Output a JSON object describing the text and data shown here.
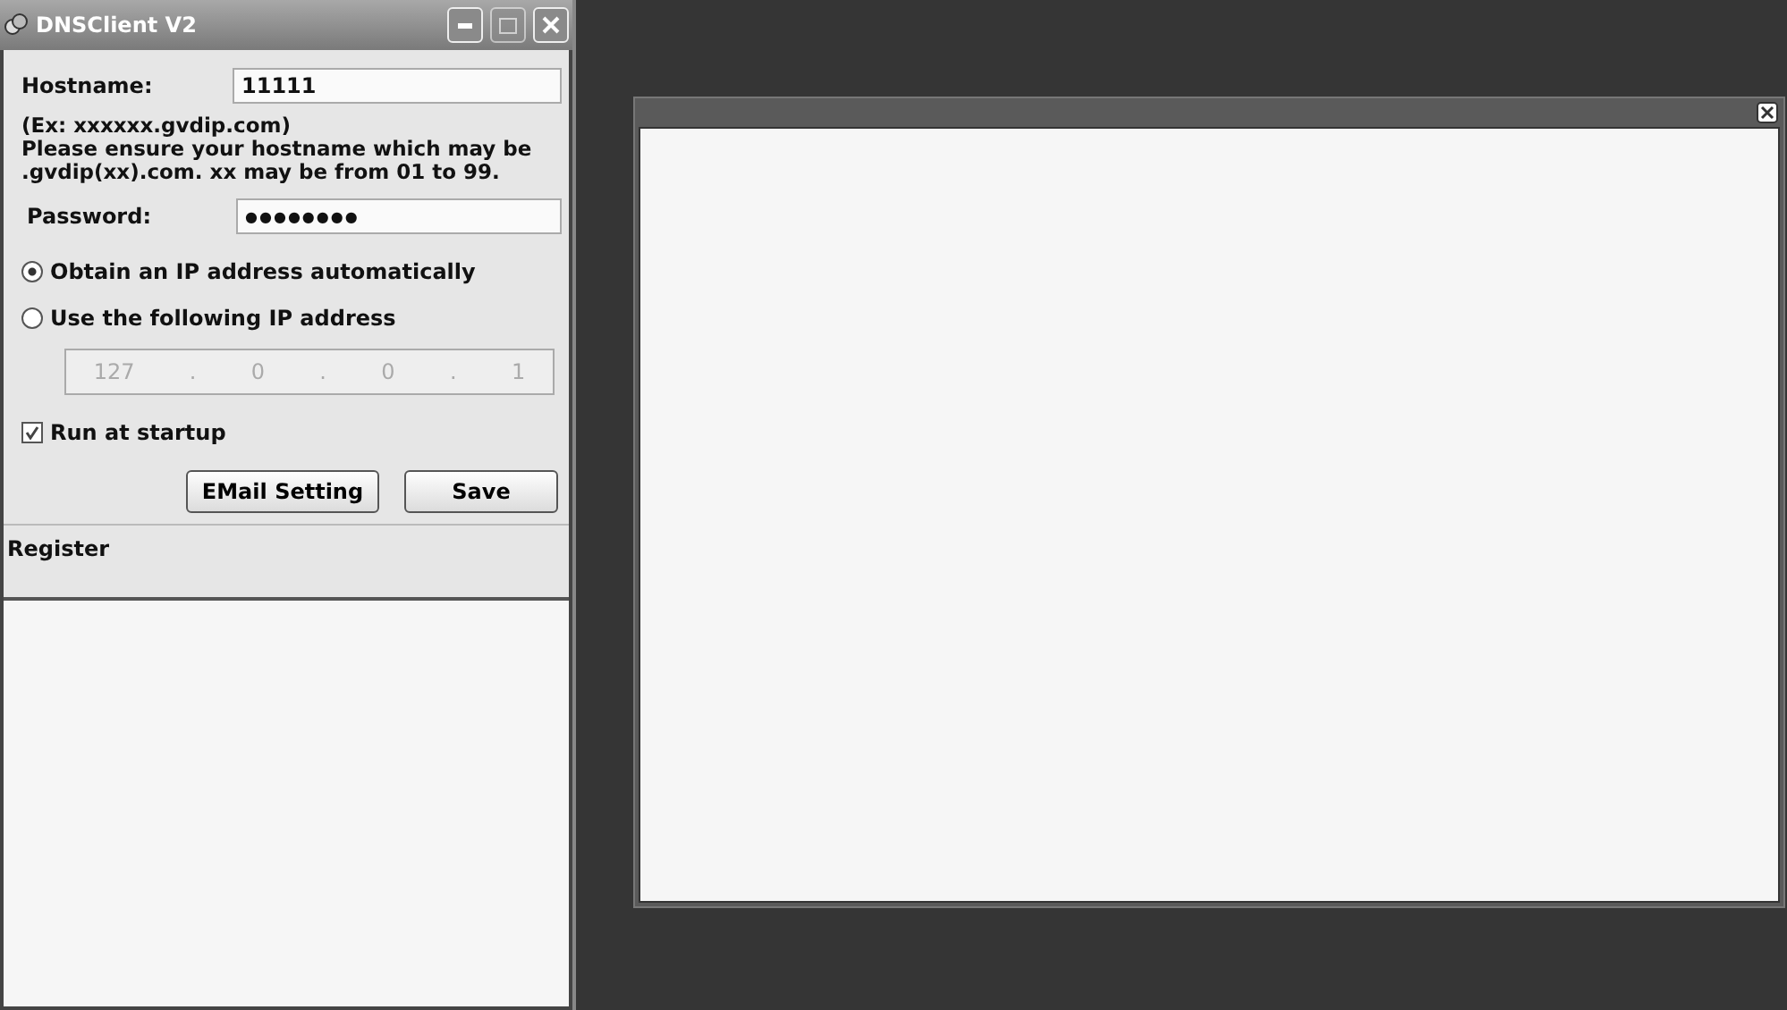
{
  "window": {
    "title": "DNSClient V2"
  },
  "hostname": {
    "label": "Hostname:",
    "value": "11111"
  },
  "hint_lines": [
    "(Ex: xxxxxx.gvdip.com)",
    "Please ensure your hostname which may be",
    ".gvdip(xx).com. xx may be from 01 to 99."
  ],
  "password": {
    "label": "Password:",
    "value": "●●●●●●●●"
  },
  "ip_options": [
    {
      "label": "Obtain an IP address automatically",
      "selected": true
    },
    {
      "label": "Use the following IP address",
      "selected": false
    }
  ],
  "ip_address": {
    "disabled": true,
    "parts": [
      "127",
      ".",
      "0",
      ".",
      "0",
      ".",
      "1"
    ]
  },
  "run_at_startup": {
    "label": "Run at startup",
    "checked": true
  },
  "buttons": [
    "EMail Setting",
    "Save"
  ],
  "register_label": "Register"
}
